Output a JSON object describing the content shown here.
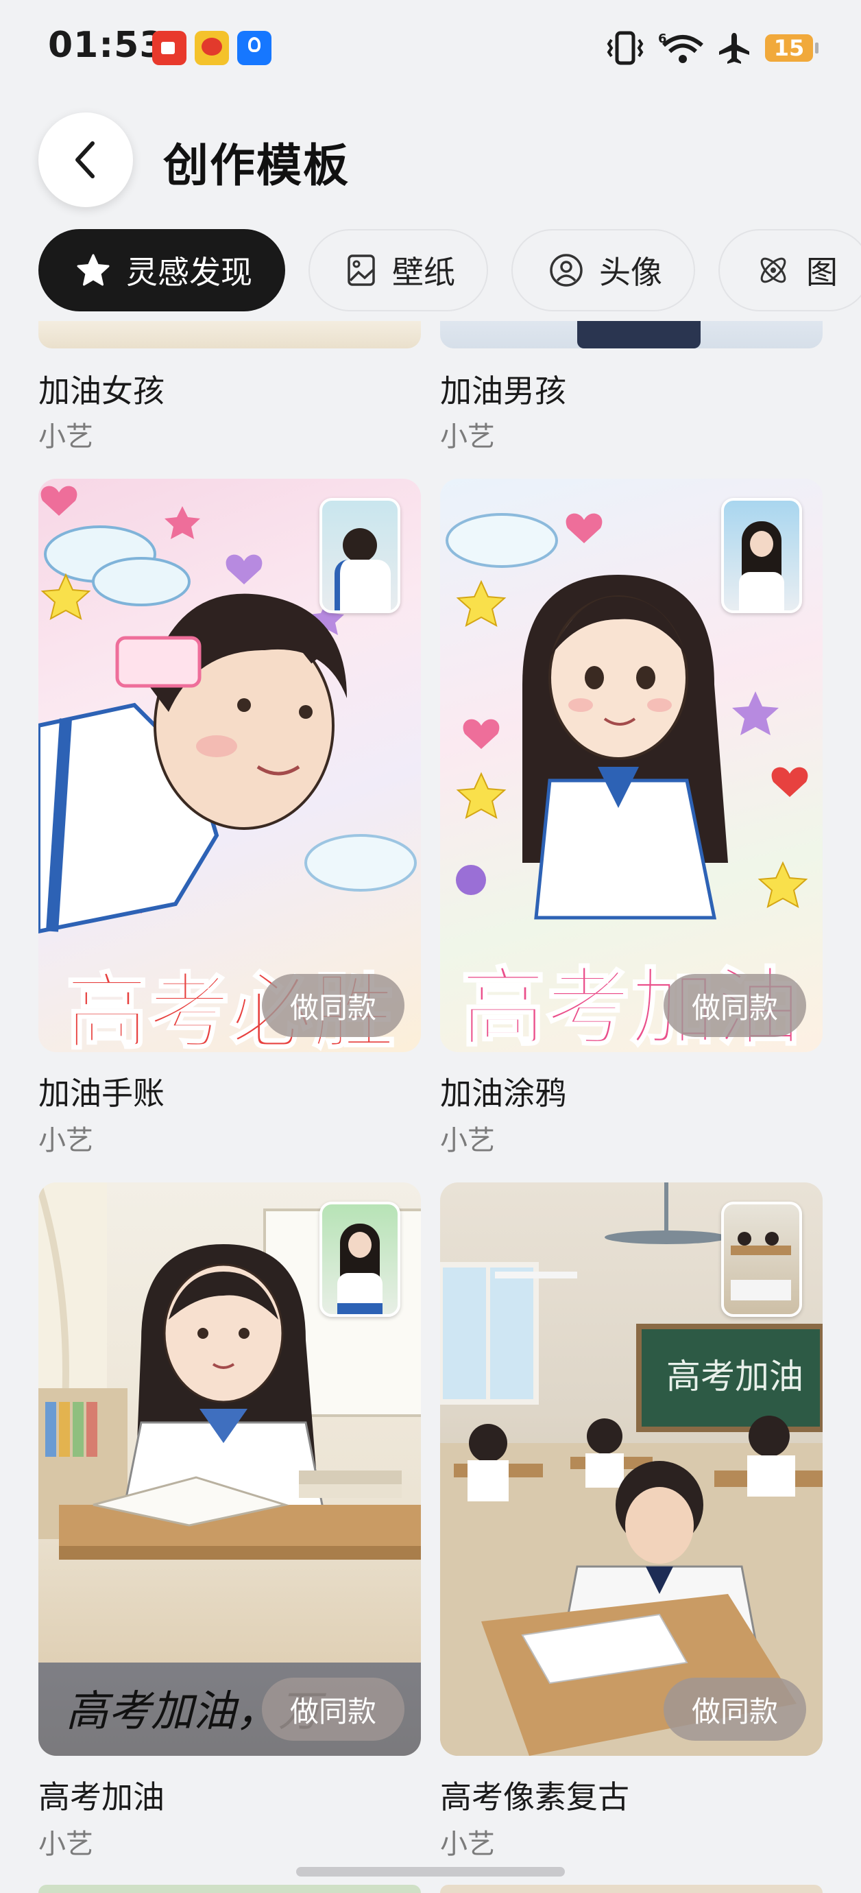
{
  "status_bar": {
    "time": "01:53",
    "notification_icons": [
      "video-app-icon",
      "weibo-app-icon",
      "lightbulb-app-icon"
    ],
    "system_icons": [
      "vibrate-icon",
      "wifi-icon",
      "airplane-icon"
    ],
    "battery_level": "15"
  },
  "header": {
    "back_icon": "chevron-left-icon",
    "title": "创作模板"
  },
  "tabs": [
    {
      "label": "灵感发现",
      "icon": "star-icon",
      "active": true
    },
    {
      "label": "壁纸",
      "icon": "image-icon",
      "active": false
    },
    {
      "label": "头像",
      "icon": "person-icon",
      "active": false
    },
    {
      "label": "图",
      "icon": "atom-icon",
      "active": false
    }
  ],
  "cards": [
    {
      "title": "加油女孩",
      "author": "小艺"
    },
    {
      "title": "加油男孩",
      "author": "小艺"
    },
    {
      "title": "加油手账",
      "author": "小艺",
      "action": "做同款",
      "image_text": "高考必胜"
    },
    {
      "title": "加油涂鸦",
      "author": "小艺",
      "action": "做同款",
      "image_text": "高考加油"
    },
    {
      "title": "高考加油",
      "author": "小艺",
      "action": "做同款",
      "image_text": "高考加油，万"
    },
    {
      "title": "高考像素复古",
      "author": "小艺",
      "action": "做同款",
      "image_text": "高考加油"
    }
  ],
  "colors": {
    "background": "#f1f2f4",
    "active_tab": "#191919",
    "battery": "#f1a93b"
  }
}
